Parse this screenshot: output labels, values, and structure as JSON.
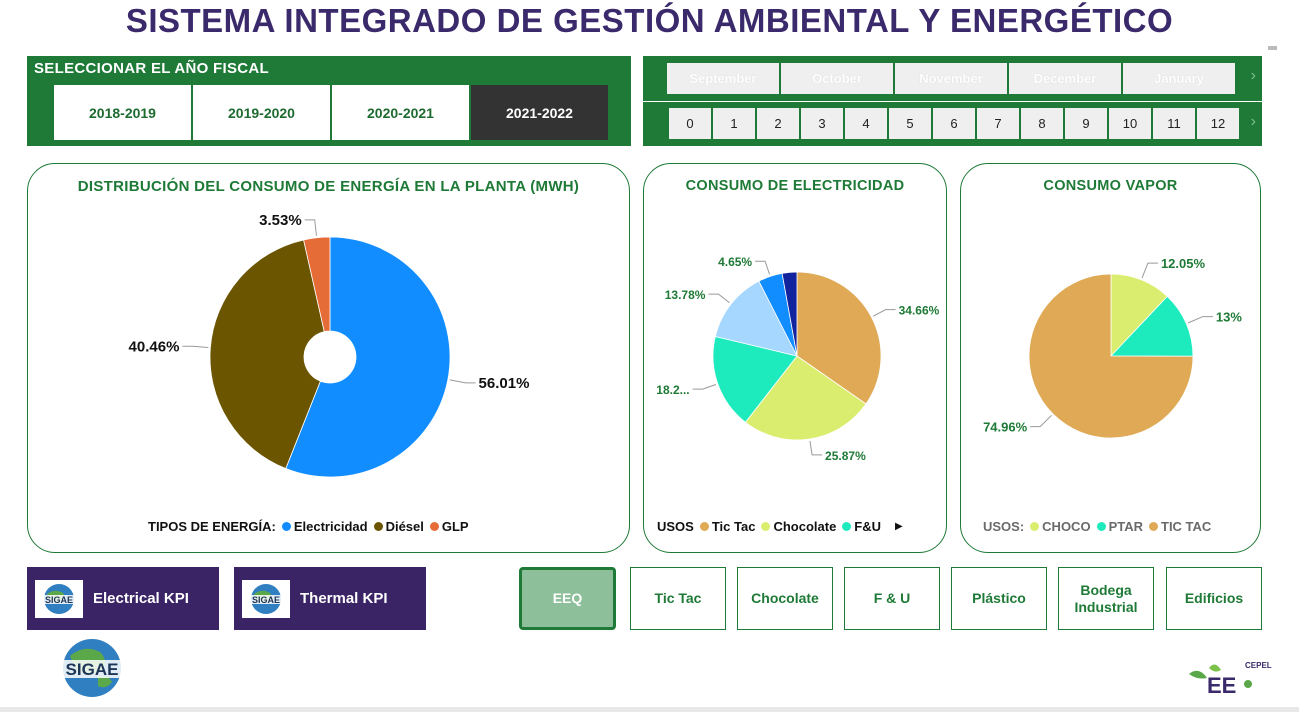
{
  "title": "SISTEMA INTEGRADO DE GESTIÓN AMBIENTAL Y ENERGÉTICO",
  "fiscal_year": {
    "label": "SELECCIONAR EL AÑO FISCAL",
    "options": [
      "2018-2019",
      "2019-2020",
      "2020-2021",
      "2021-2022"
    ],
    "selected": "2021-2022"
  },
  "months": [
    "September",
    "October",
    "November",
    "December",
    "January"
  ],
  "month_numbers": [
    "0",
    "1",
    "2",
    "3",
    "4",
    "5",
    "6",
    "7",
    "8",
    "9",
    "10",
    "11",
    "12"
  ],
  "energy_card": {
    "title": "DISTRIBUCIÓN DEL CONSUMO DE ENERGÍA EN LA PLANTA (MWH)",
    "legend_title": "TIPOS DE ENERGÍA:",
    "legend": [
      "Electricidad",
      "Diésel",
      "GLP"
    ]
  },
  "electricity_card": {
    "title": "CONSUMO DE ELECTRICIDAD",
    "legend_title": "USOS",
    "legend": [
      "Tic Tac",
      "Chocolate",
      "F&U"
    ]
  },
  "vapor_card": {
    "title": "CONSUMO VAPOR",
    "legend_title": "USOS:",
    "legend": [
      "CHOCO",
      "PTAR",
      "TIC TAC"
    ]
  },
  "chart_data": [
    {
      "type": "pie",
      "title": "DISTRIBUCIÓN DEL CONSUMO DE ENERGÍA EN LA PLANTA (MWH)",
      "categories": [
        "Electricidad",
        "Diésel",
        "GLP"
      ],
      "values": [
        56.01,
        40.46,
        3.53
      ],
      "labels": [
        "56.01%",
        "40.46%",
        "3.53%"
      ],
      "colors": [
        "#118dff",
        "#6b5500",
        "#e66c37"
      ],
      "legend": "bottom"
    },
    {
      "type": "pie",
      "title": "CONSUMO DE ELECTRICIDAD",
      "categories": [
        "Tic Tac",
        "Chocolate",
        "F&U",
        "",
        "",
        ""
      ],
      "values": [
        34.66,
        25.87,
        18.2,
        13.78,
        4.65,
        2.84
      ],
      "labels": [
        "34.66%",
        "25.87%",
        "18.2...",
        "13.78%",
        "4.65%",
        ""
      ],
      "colors": [
        "#dfa955",
        "#dbed6e",
        "#1eebbd",
        "#a6d7ff",
        "#118dff",
        "#12239e"
      ],
      "legend": "bottom"
    },
    {
      "type": "pie",
      "title": "CONSUMO VAPOR",
      "categories": [
        "CHOCO",
        "PTAR",
        "TIC TAC"
      ],
      "values": [
        12.05,
        13,
        74.96
      ],
      "labels": [
        "12.05%",
        "13%",
        "74.96%"
      ],
      "colors": [
        "#dbed6e",
        "#1eebbd",
        "#dfa955"
      ],
      "legend": "bottom"
    }
  ],
  "kpi_buttons": [
    "Electrical KPI",
    "Thermal KPI"
  ],
  "kpi_logo_text": "SIGAE",
  "nav_buttons": [
    "EEQ",
    "Tic Tac",
    "Chocolate",
    "F & U",
    "Plástico",
    "Bodega Industrial",
    "Edificios"
  ],
  "nav_active": "EEQ",
  "logo_left_text": "SIGAE",
  "logo_right_text": "EE",
  "logo_right_small": "CEPEL",
  "label_color": "#1e7a36"
}
